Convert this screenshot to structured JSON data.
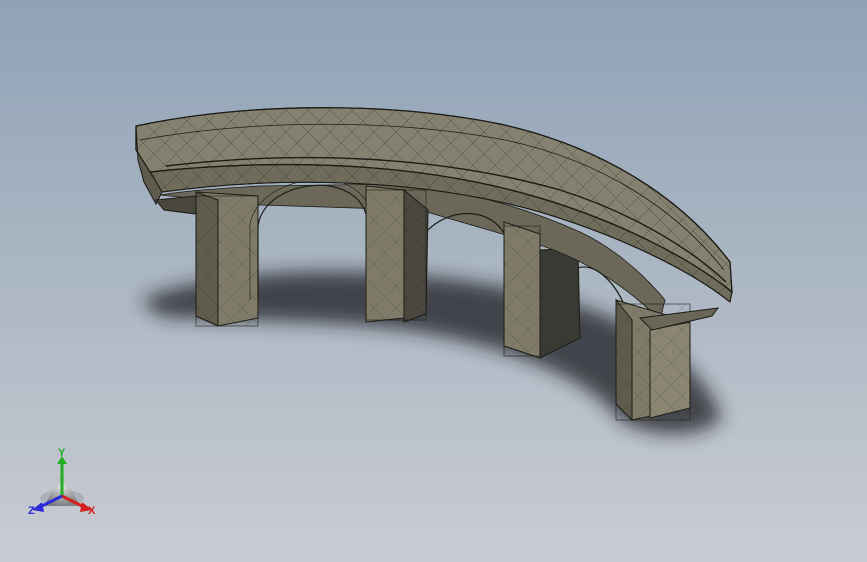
{
  "viewport": {
    "background_top": "#8fa2b7",
    "background_bottom": "#c9ccd3"
  },
  "model": {
    "name": "curved-arch-bridge",
    "face_color": "#7f7b68",
    "edge_color": "#1c1c16",
    "shadow_color": "#1a1c20",
    "arch_count": 3,
    "pier_count": 4
  },
  "triad": {
    "x_label": "X",
    "y_label": "Y",
    "z_label": "Z",
    "x_color": "#d42020",
    "y_color": "#22b022",
    "z_color": "#2a2ad6"
  }
}
